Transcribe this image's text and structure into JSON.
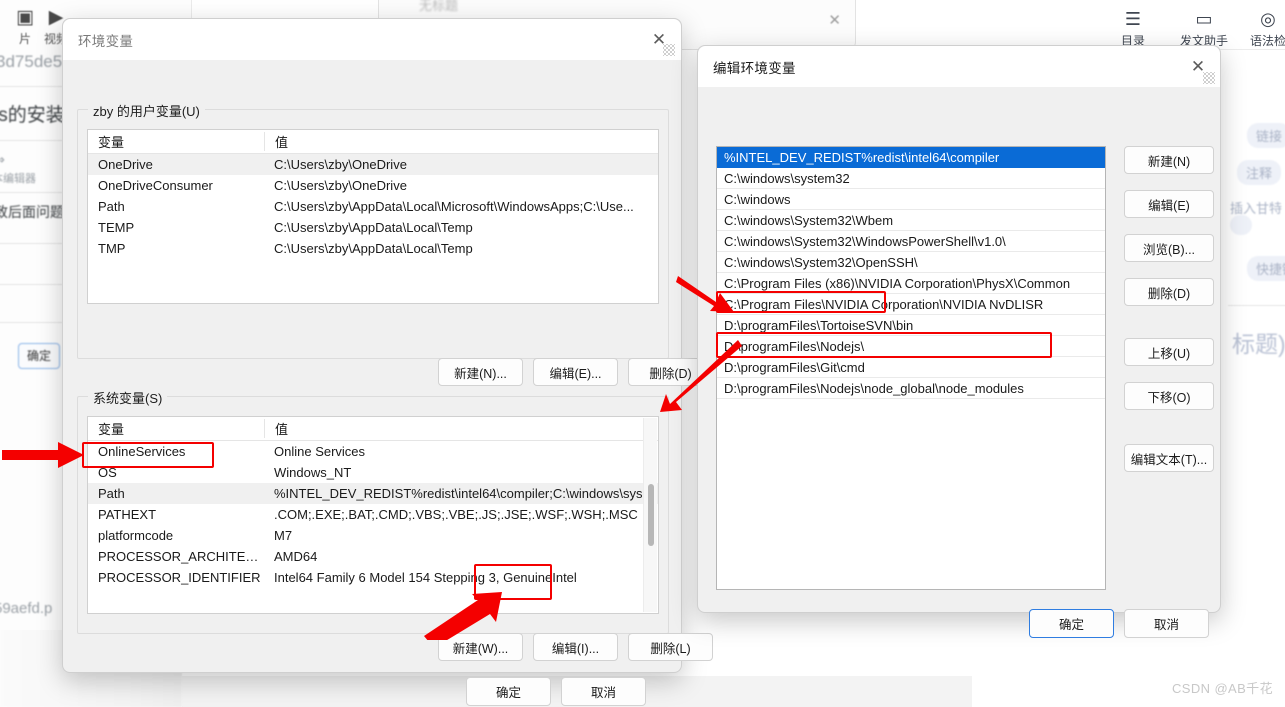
{
  "background": {
    "toolbar_items": [
      {
        "icon": "image-icon",
        "glyph": "▣",
        "label": "片"
      },
      {
        "icon": "video-icon",
        "glyph": "▶",
        "label": "视频"
      }
    ],
    "texts": [
      "3d75de5",
      "js的安装",
      "本编辑器",
      "致后面问题多",
      "59aefd.p"
    ],
    "ok_button": "确定",
    "right_toolbar": [
      {
        "icon": "toc-icon",
        "glyph": "☰",
        "label": "目录"
      },
      {
        "icon": "assistant-icon",
        "glyph": "▭",
        "label": "发文助手"
      },
      {
        "icon": "grammar-icon",
        "glyph": "◎",
        "label": "语法检"
      }
    ],
    "right_panel_items": [
      "链接",
      "注释",
      "插入甘特",
      "快捷键"
    ],
    "right_panel_title": "标题)"
  },
  "env_dialog": {
    "title": "环境变量",
    "close_icon": "close-icon",
    "user_group_label": "zby 的用户变量(U)",
    "system_group_label": "系统变量(S)",
    "columns": [
      "变量",
      "值"
    ],
    "user_rows": [
      {
        "name": "OneDrive",
        "value": "C:\\Users\\zby\\OneDrive",
        "selected": true
      },
      {
        "name": "OneDriveConsumer",
        "value": "C:\\Users\\zby\\OneDrive",
        "selected": false
      },
      {
        "name": "Path",
        "value": "C:\\Users\\zby\\AppData\\Local\\Microsoft\\WindowsApps;C:\\Use...",
        "selected": false
      },
      {
        "name": "TEMP",
        "value": "C:\\Users\\zby\\AppData\\Local\\Temp",
        "selected": false
      },
      {
        "name": "TMP",
        "value": "C:\\Users\\zby\\AppData\\Local\\Temp",
        "selected": false
      }
    ],
    "system_rows": [
      {
        "name": "OnlineServices",
        "value": "Online Services",
        "selected": false
      },
      {
        "name": "OS",
        "value": "Windows_NT",
        "selected": false
      },
      {
        "name": "Path",
        "value": "%INTEL_DEV_REDIST%redist\\intel64\\compiler;C:\\windows\\sys...",
        "selected": true
      },
      {
        "name": "PATHEXT",
        "value": ".COM;.EXE;.BAT;.CMD;.VBS;.VBE;.JS;.JSE;.WSF;.WSH;.MSC",
        "selected": false
      },
      {
        "name": "platformcode",
        "value": "M7",
        "selected": false
      },
      {
        "name": "PROCESSOR_ARCHITECT...",
        "value": "AMD64",
        "selected": false
      },
      {
        "name": "PROCESSOR_IDENTIFIER",
        "value": "Intel64 Family 6 Model 154 Stepping 3, GenuineIntel",
        "selected": false
      }
    ],
    "user_buttons": [
      "新建(N)...",
      "编辑(E)...",
      "删除(D)"
    ],
    "system_buttons": [
      "新建(W)...",
      "编辑(I)...",
      "删除(L)"
    ],
    "footer_buttons": [
      "确定",
      "取消"
    ]
  },
  "edit_dialog": {
    "title": "编辑环境变量",
    "close_icon": "close-icon",
    "entries": [
      {
        "text": "%INTEL_DEV_REDIST%redist\\intel64\\compiler",
        "selected": true
      },
      {
        "text": "C:\\windows\\system32",
        "selected": false
      },
      {
        "text": "C:\\windows",
        "selected": false
      },
      {
        "text": "C:\\windows\\System32\\Wbem",
        "selected": false
      },
      {
        "text": "C:\\windows\\System32\\WindowsPowerShell\\v1.0\\",
        "selected": false
      },
      {
        "text": "C:\\windows\\System32\\OpenSSH\\",
        "selected": false
      },
      {
        "text": "C:\\Program Files (x86)\\NVIDIA Corporation\\PhysX\\Common",
        "selected": false
      },
      {
        "text": "C:\\Program Files\\NVIDIA Corporation\\NVIDIA NvDLISR",
        "selected": false
      },
      {
        "text": "D:\\programFiles\\TortoiseSVN\\bin",
        "selected": false
      },
      {
        "text": "D:\\programFiles\\Nodejs\\",
        "selected": false
      },
      {
        "text": "D:\\programFiles\\Git\\cmd",
        "selected": false
      },
      {
        "text": "D:\\programFiles\\Nodejs\\node_global\\node_modules",
        "selected": false
      }
    ],
    "side_buttons": [
      "新建(N)",
      "编辑(E)",
      "浏览(B)...",
      "删除(D)",
      "上移(U)",
      "下移(O)",
      "编辑文本(T)..."
    ],
    "footer_buttons": [
      "确定",
      "取消"
    ]
  },
  "watermark": "CSDN @AB千花",
  "colors": {
    "accent_blue": "#0a6bd6",
    "annotation_red": "#f40000",
    "dialog_bg": "#f0f0f0",
    "title_bg": "#ffffff"
  }
}
